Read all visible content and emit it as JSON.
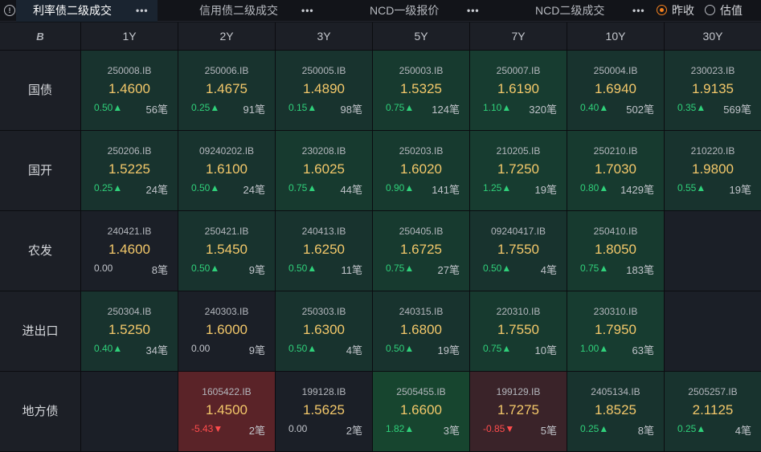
{
  "tabs": [
    {
      "label": "利率债二级成交",
      "active": true
    },
    {
      "label": "信用债二级成交",
      "active": false
    },
    {
      "label": "NCD一级报价",
      "active": false
    },
    {
      "label": "NCD二级成交",
      "active": false
    }
  ],
  "more_glyph": "•••",
  "radio": {
    "prev_close": "昨收",
    "valuation": "估值",
    "selected": "prev_close"
  },
  "corner_logo": "B",
  "tenors": [
    "1Y",
    "2Y",
    "3Y",
    "5Y",
    "7Y",
    "10Y",
    "30Y"
  ],
  "rows": [
    {
      "label": "国债",
      "cells": [
        {
          "code": "250008.IB",
          "yield": "1.4600",
          "chg": "0.50▲",
          "dir": "up",
          "cnt": "56笔",
          "bg": "#18332e"
        },
        {
          "code": "250006.IB",
          "yield": "1.4675",
          "chg": "0.25▲",
          "dir": "up",
          "cnt": "91笔",
          "bg": "#18332e"
        },
        {
          "code": "250005.IB",
          "yield": "1.4890",
          "chg": "0.15▲",
          "dir": "up",
          "cnt": "98笔",
          "bg": "#18332e"
        },
        {
          "code": "250003.IB",
          "yield": "1.5325",
          "chg": "0.75▲",
          "dir": "up",
          "cnt": "124笔",
          "bg": "#173a2f"
        },
        {
          "code": "250007.IB",
          "yield": "1.6190",
          "chg": "1.10▲",
          "dir": "up",
          "cnt": "320笔",
          "bg": "#173c30"
        },
        {
          "code": "250004.IB",
          "yield": "1.6940",
          "chg": "0.40▲",
          "dir": "up",
          "cnt": "502笔",
          "bg": "#18332e"
        },
        {
          "code": "230023.IB",
          "yield": "1.9135",
          "chg": "0.35▲",
          "dir": "up",
          "cnt": "569笔",
          "bg": "#18332e"
        }
      ]
    },
    {
      "label": "国开",
      "cells": [
        {
          "code": "250206.IB",
          "yield": "1.5225",
          "chg": "0.25▲",
          "dir": "up",
          "cnt": "24笔",
          "bg": "#18332e"
        },
        {
          "code": "09240202.IB",
          "yield": "1.6100",
          "chg": "0.50▲",
          "dir": "up",
          "cnt": "24笔",
          "bg": "#18332e"
        },
        {
          "code": "230208.IB",
          "yield": "1.6025",
          "chg": "0.75▲",
          "dir": "up",
          "cnt": "44笔",
          "bg": "#173a2f"
        },
        {
          "code": "250203.IB",
          "yield": "1.6020",
          "chg": "0.90▲",
          "dir": "up",
          "cnt": "141笔",
          "bg": "#173a2f"
        },
        {
          "code": "210205.IB",
          "yield": "1.7250",
          "chg": "1.25▲",
          "dir": "up",
          "cnt": "19笔",
          "bg": "#173c30"
        },
        {
          "code": "250210.IB",
          "yield": "1.7030",
          "chg": "0.80▲",
          "dir": "up",
          "cnt": "1429笔",
          "bg": "#173a2f"
        },
        {
          "code": "210220.IB",
          "yield": "1.9800",
          "chg": "0.55▲",
          "dir": "up",
          "cnt": "19笔",
          "bg": "#18332e"
        }
      ]
    },
    {
      "label": "农发",
      "cells": [
        {
          "code": "240421.IB",
          "yield": "1.4600",
          "chg": "0.00",
          "dir": "flat",
          "cnt": "8笔",
          "bg": "#1b1f27"
        },
        {
          "code": "250421.IB",
          "yield": "1.5450",
          "chg": "0.50▲",
          "dir": "up",
          "cnt": "9笔",
          "bg": "#18332e"
        },
        {
          "code": "240413.IB",
          "yield": "1.6250",
          "chg": "0.50▲",
          "dir": "up",
          "cnt": "11笔",
          "bg": "#18332e"
        },
        {
          "code": "250405.IB",
          "yield": "1.6725",
          "chg": "0.75▲",
          "dir": "up",
          "cnt": "27笔",
          "bg": "#173a2f"
        },
        {
          "code": "09240417.IB",
          "yield": "1.7550",
          "chg": "0.50▲",
          "dir": "up",
          "cnt": "4笔",
          "bg": "#18332e"
        },
        {
          "code": "250410.IB",
          "yield": "1.8050",
          "chg": "0.75▲",
          "dir": "up",
          "cnt": "183笔",
          "bg": "#173a2f"
        },
        {
          "code": "",
          "yield": "",
          "chg": "",
          "dir": "flat",
          "cnt": "",
          "bg": "#1b1f27"
        }
      ]
    },
    {
      "label": "进出口",
      "cells": [
        {
          "code": "250304.IB",
          "yield": "1.5250",
          "chg": "0.40▲",
          "dir": "up",
          "cnt": "34笔",
          "bg": "#18332e"
        },
        {
          "code": "240303.IB",
          "yield": "1.6000",
          "chg": "0.00",
          "dir": "flat",
          "cnt": "9笔",
          "bg": "#1b1f27"
        },
        {
          "code": "250303.IB",
          "yield": "1.6300",
          "chg": "0.50▲",
          "dir": "up",
          "cnt": "4笔",
          "bg": "#18332e"
        },
        {
          "code": "240315.IB",
          "yield": "1.6800",
          "chg": "0.50▲",
          "dir": "up",
          "cnt": "19笔",
          "bg": "#18332e"
        },
        {
          "code": "220310.IB",
          "yield": "1.7550",
          "chg": "0.75▲",
          "dir": "up",
          "cnt": "10笔",
          "bg": "#173a2f"
        },
        {
          "code": "230310.IB",
          "yield": "1.7950",
          "chg": "1.00▲",
          "dir": "up",
          "cnt": "63笔",
          "bg": "#173c30"
        },
        {
          "code": "",
          "yield": "",
          "chg": "",
          "dir": "flat",
          "cnt": "",
          "bg": "#1b1f27"
        }
      ]
    },
    {
      "label": "地方债",
      "cells": [
        {
          "code": "",
          "yield": "",
          "chg": "",
          "dir": "flat",
          "cnt": "",
          "bg": "#1b1f27"
        },
        {
          "code": "1605422.IB",
          "yield": "1.4500",
          "chg": "-5.43▼",
          "dir": "down",
          "cnt": "2笔",
          "bg": "#5a2328"
        },
        {
          "code": "199128.IB",
          "yield": "1.5625",
          "chg": "0.00",
          "dir": "flat",
          "cnt": "2笔",
          "bg": "#1b1f27"
        },
        {
          "code": "2505455.IB",
          "yield": "1.6600",
          "chg": "1.82▲",
          "dir": "up",
          "cnt": "3笔",
          "bg": "#17452f"
        },
        {
          "code": "199129.IB",
          "yield": "1.7275",
          "chg": "-0.85▼",
          "dir": "down",
          "cnt": "5笔",
          "bg": "#3a2329"
        },
        {
          "code": "2405134.IB",
          "yield": "1.8525",
          "chg": "0.25▲",
          "dir": "up",
          "cnt": "8笔",
          "bg": "#18332e"
        },
        {
          "code": "2505257.IB",
          "yield": "2.1125",
          "chg": "0.25▲",
          "dir": "up",
          "cnt": "4笔",
          "bg": "#18332e"
        }
      ]
    }
  ]
}
